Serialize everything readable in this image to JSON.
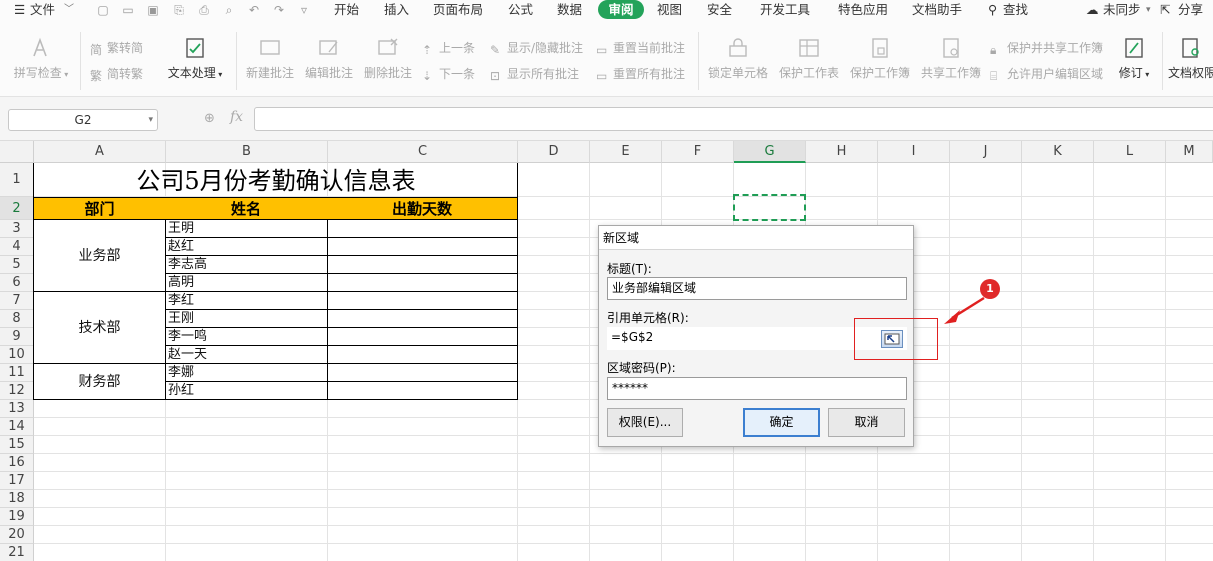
{
  "menu": {
    "file": "文件",
    "tabs": [
      "开始",
      "插入",
      "页面布局",
      "公式",
      "数据",
      "审阅",
      "视图",
      "安全",
      "开发工具",
      "特色应用",
      "文档助手"
    ],
    "active_tab": "审阅",
    "search": "查找",
    "sync": "未同步",
    "share": "分享"
  },
  "ribbon": {
    "spell_check": "拼写检查",
    "trad_to_simp": "繁转简",
    "simp_to_trad": "简转繁",
    "text_process": "文本处理",
    "new_comment": "新建批注",
    "edit_comment": "编辑批注",
    "delete_comment": "删除批注",
    "prev": "上一条",
    "next": "下一条",
    "show_hide_comment": "显示/隐藏批注",
    "show_all_comments": "显示所有批注",
    "reset_current_comment": "重置当前批注",
    "reset_all_comments": "重置所有批注",
    "lock_cell": "锁定单元格",
    "protect_sheet": "保护工作表",
    "protect_workbook": "保护工作簿",
    "share_workbook": "共享工作簿",
    "protect_share_workbook": "保护并共享工作簿",
    "allow_user_edit": "允许用户编辑区域",
    "revise": "修订",
    "doc_permission": "文档权限"
  },
  "formula_bar": {
    "name_box": "G2",
    "fx": "fx",
    "formula": ""
  },
  "columns": [
    "A",
    "B",
    "C",
    "D",
    "E",
    "F",
    "G",
    "H",
    "I",
    "J",
    "K",
    "L",
    "M"
  ],
  "selected_column": "G",
  "rows": [
    "1",
    "2",
    "3",
    "4",
    "5",
    "6",
    "7",
    "8",
    "9",
    "10",
    "11",
    "12",
    "13",
    "14",
    "15",
    "16",
    "17",
    "18",
    "19",
    "20",
    "21"
  ],
  "sheet": {
    "title": "公司5月份考勤确认信息表",
    "headers": [
      "部门",
      "姓名",
      "出勤天数"
    ],
    "departments": [
      "业务部",
      "技术部",
      "财务部"
    ],
    "names": [
      "王明",
      "赵红",
      "李志高",
      "高明",
      "李红",
      "王刚",
      "李一鸣",
      "赵一天",
      "李娜",
      "孙红"
    ]
  },
  "dialog": {
    "title": "新区域",
    "label_title": "标题(T):",
    "title_value": "业务部编辑区域",
    "label_ref": "引用单元格(R):",
    "ref_value": "=$G$2",
    "label_password": "区域密码(P):",
    "password_value": "******",
    "permission_button": "权限(E)...",
    "ok_button": "确定",
    "cancel_button": "取消"
  },
  "annotation": {
    "badge": "1",
    "color": "#e02020"
  },
  "colors": {
    "accent_green": "#23a35a",
    "header_fill": "#ffc000"
  }
}
